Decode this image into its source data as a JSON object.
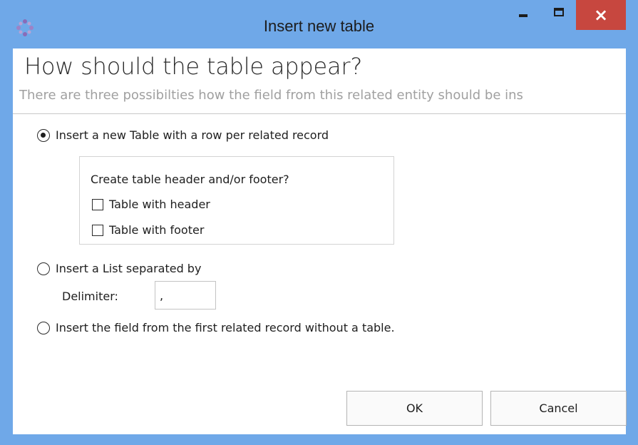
{
  "window": {
    "title": "Insert new table",
    "close_glyph": "×",
    "icon": "app-logo-icon"
  },
  "header": {
    "heading": "How should the table appear?",
    "subheading": "There are three possibilties how the field from this  related entity should be ins"
  },
  "options": {
    "table_option": {
      "label": "Insert a new Table with a row per related record",
      "checked": true
    },
    "list_option": {
      "label": "Insert a List separated by",
      "checked": false
    },
    "first_option": {
      "label": "Insert the field from the first related record without a table.",
      "checked": false
    }
  },
  "table_settings": {
    "prompt": "Create table header and/or footer?",
    "header_checkbox": {
      "label": "Table with header",
      "checked": false
    },
    "footer_checkbox": {
      "label": "Table with footer",
      "checked": false
    }
  },
  "delimiter": {
    "label": "Delimiter:",
    "value": ","
  },
  "buttons": {
    "ok": "OK",
    "cancel": "Cancel"
  },
  "colors": {
    "titlebar": "#6fa8e8",
    "close": "#c7473f",
    "subheading": "#a0a0a0"
  }
}
